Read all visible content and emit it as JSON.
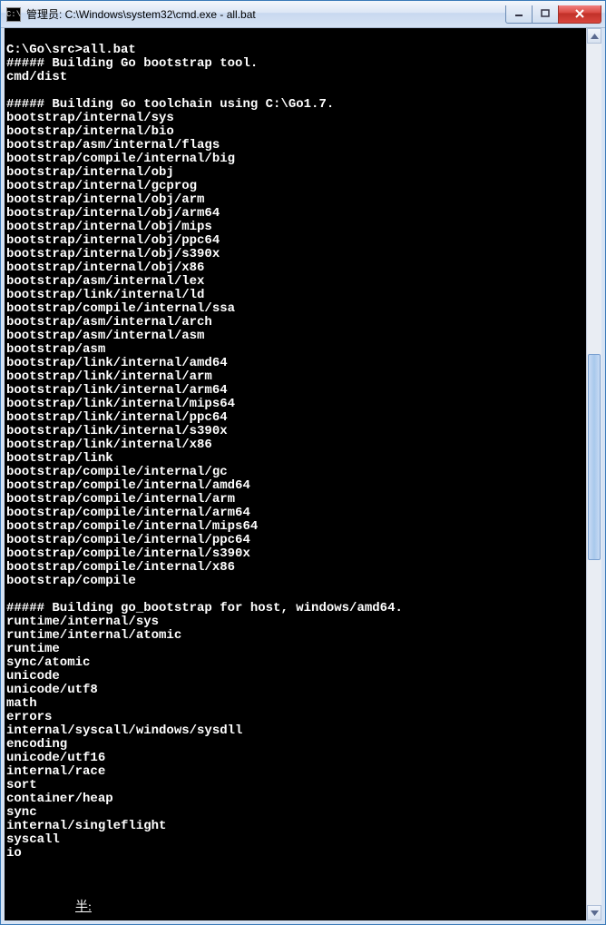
{
  "titlebar": {
    "icon_text": "C:\\",
    "title": "管理员: C:\\Windows\\system32\\cmd.exe - all.bat"
  },
  "window_controls": {
    "min_tip": "Minimize",
    "max_tip": "Maximize",
    "close_tip": "Close"
  },
  "console": {
    "blank": "",
    "prompt": "C:\\Go\\src>all.bat",
    "h1": "##### Building Go bootstrap tool.",
    "l1": "cmd/dist",
    "h2": "##### Building Go toolchain using C:\\Go1.7.",
    "b": [
      "bootstrap/internal/sys",
      "bootstrap/internal/bio",
      "bootstrap/asm/internal/flags",
      "bootstrap/compile/internal/big",
      "bootstrap/internal/obj",
      "bootstrap/internal/gcprog",
      "bootstrap/internal/obj/arm",
      "bootstrap/internal/obj/arm64",
      "bootstrap/internal/obj/mips",
      "bootstrap/internal/obj/ppc64",
      "bootstrap/internal/obj/s390x",
      "bootstrap/internal/obj/x86",
      "bootstrap/asm/internal/lex",
      "bootstrap/link/internal/ld",
      "bootstrap/compile/internal/ssa",
      "bootstrap/asm/internal/arch",
      "bootstrap/asm/internal/asm",
      "bootstrap/asm",
      "bootstrap/link/internal/amd64",
      "bootstrap/link/internal/arm",
      "bootstrap/link/internal/arm64",
      "bootstrap/link/internal/mips64",
      "bootstrap/link/internal/ppc64",
      "bootstrap/link/internal/s390x",
      "bootstrap/link/internal/x86",
      "bootstrap/link",
      "bootstrap/compile/internal/gc",
      "bootstrap/compile/internal/amd64",
      "bootstrap/compile/internal/arm",
      "bootstrap/compile/internal/arm64",
      "bootstrap/compile/internal/mips64",
      "bootstrap/compile/internal/ppc64",
      "bootstrap/compile/internal/s390x",
      "bootstrap/compile/internal/x86",
      "bootstrap/compile"
    ],
    "h3": "##### Building go_bootstrap for host, windows/amd64.",
    "r": [
      "runtime/internal/sys",
      "runtime/internal/atomic",
      "runtime",
      "sync/atomic",
      "unicode",
      "unicode/utf8",
      "math",
      "errors",
      "internal/syscall/windows/sysdll",
      "encoding",
      "unicode/utf16",
      "internal/race",
      "sort",
      "container/heap",
      "sync",
      "internal/singleflight",
      "syscall",
      "io"
    ],
    "ime": "半:"
  }
}
